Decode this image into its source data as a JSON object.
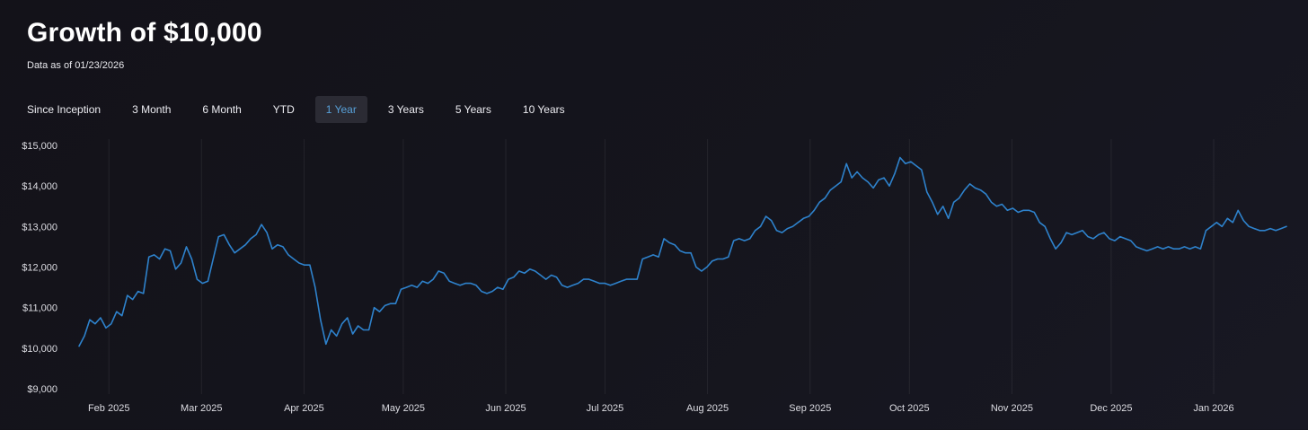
{
  "page": {
    "title": "Growth of $10,000",
    "as_of": "Data as of 01/23/2026"
  },
  "tabs": {
    "items": [
      {
        "label": "Since Inception",
        "selected": false
      },
      {
        "label": "3 Month",
        "selected": false
      },
      {
        "label": "6 Month",
        "selected": false
      },
      {
        "label": "YTD",
        "selected": false
      },
      {
        "label": "1 Year",
        "selected": true
      },
      {
        "label": "3 Years",
        "selected": false
      },
      {
        "label": "5 Years",
        "selected": false
      },
      {
        "label": "10 Years",
        "selected": false
      }
    ]
  },
  "colors": {
    "background": "#15151d",
    "line": "#2e82cc",
    "tab_selected_bg": "#2b2b34",
    "tab_selected_text": "#58a1d9",
    "axis_text": "#dcdce2"
  },
  "chart_data": {
    "type": "line",
    "title": "Growth of $10,000",
    "subtitle": "Data as of 01/23/2026",
    "selected_range": "1 Year",
    "legend": "none",
    "grid": "vertical month gridlines only",
    "ylim": [
      9000,
      15000
    ],
    "y_ticks": [
      15000,
      14000,
      13000,
      12000,
      11000,
      10000,
      9000
    ],
    "y_tick_labels": [
      "$15,000",
      "$14,000",
      "$13,000",
      "$12,000",
      "$11,000",
      "$10,000",
      "$9,000"
    ],
    "x_ticks": [
      {
        "label": "Feb 2025",
        "frac": 0.0247
      },
      {
        "label": "Mar 2025",
        "frac": 0.1014
      },
      {
        "label": "Apr 2025",
        "frac": 0.1863
      },
      {
        "label": "May 2025",
        "frac": 0.2685
      },
      {
        "label": "Jun 2025",
        "frac": 0.3534
      },
      {
        "label": "Jul 2025",
        "frac": 0.4356
      },
      {
        "label": "Aug 2025",
        "frac": 0.5205
      },
      {
        "label": "Sep 2025",
        "frac": 0.6055
      },
      {
        "label": "Oct 2025",
        "frac": 0.6877
      },
      {
        "label": "Nov 2025",
        "frac": 0.7726
      },
      {
        "label": "Dec 2025",
        "frac": 0.8548
      },
      {
        "label": "Jan 2026",
        "frac": 0.9397
      }
    ],
    "line_color": "#2e82cc",
    "values": [
      10050,
      10300,
      10700,
      10600,
      10750,
      10500,
      10600,
      10900,
      10800,
      11300,
      11200,
      11400,
      11350,
      12250,
      12300,
      12200,
      12450,
      12400,
      11950,
      12100,
      12500,
      12200,
      11700,
      11600,
      11650,
      12200,
      12750,
      12800,
      12550,
      12350,
      12450,
      12550,
      12700,
      12800,
      13050,
      12850,
      12450,
      12550,
      12500,
      12300,
      12200,
      12100,
      12050,
      12050,
      11500,
      10700,
      10100,
      10450,
      10300,
      10600,
      10750,
      10350,
      10550,
      10450,
      10450,
      11000,
      10900,
      11050,
      11100,
      11100,
      11450,
      11500,
      11550,
      11500,
      11650,
      11600,
      11700,
      11900,
      11850,
      11650,
      11600,
      11550,
      11600,
      11600,
      11550,
      11400,
      11350,
      11400,
      11500,
      11450,
      11700,
      11750,
      11900,
      11850,
      11950,
      11900,
      11800,
      11700,
      11800,
      11750,
      11550,
      11500,
      11550,
      11600,
      11700,
      11700,
      11650,
      11600,
      11600,
      11550,
      11600,
      11650,
      11700,
      11700,
      11700,
      12200,
      12250,
      12300,
      12250,
      12700,
      12600,
      12550,
      12400,
      12350,
      12350,
      12000,
      11900,
      12000,
      12150,
      12200,
      12200,
      12250,
      12650,
      12700,
      12650,
      12700,
      12900,
      13000,
      13250,
      13150,
      12900,
      12850,
      12950,
      13000,
      13100,
      13200,
      13250,
      13400,
      13600,
      13700,
      13900,
      14000,
      14100,
      14550,
      14200,
      14350,
      14200,
      14100,
      13950,
      14150,
      14200,
      14000,
      14300,
      14700,
      14550,
      14600,
      14500,
      14400,
      13850,
      13600,
      13300,
      13500,
      13200,
      13600,
      13700,
      13900,
      14050,
      13950,
      13900,
      13800,
      13600,
      13500,
      13550,
      13400,
      13450,
      13350,
      13400,
      13400,
      13350,
      13100,
      13000,
      12700,
      12450,
      12600,
      12850,
      12800,
      12850,
      12900,
      12750,
      12700,
      12800,
      12850,
      12700,
      12650,
      12750,
      12700,
      12650,
      12500,
      12450,
      12400,
      12450,
      12500,
      12450,
      12500,
      12450,
      12450,
      12500,
      12450,
      12500,
      12450,
      12900,
      13000,
      13100,
      13000,
      13200,
      13100,
      13400,
      13150,
      13000,
      12950,
      12900,
      12900,
      12950,
      12900,
      12950,
      13000
    ]
  }
}
